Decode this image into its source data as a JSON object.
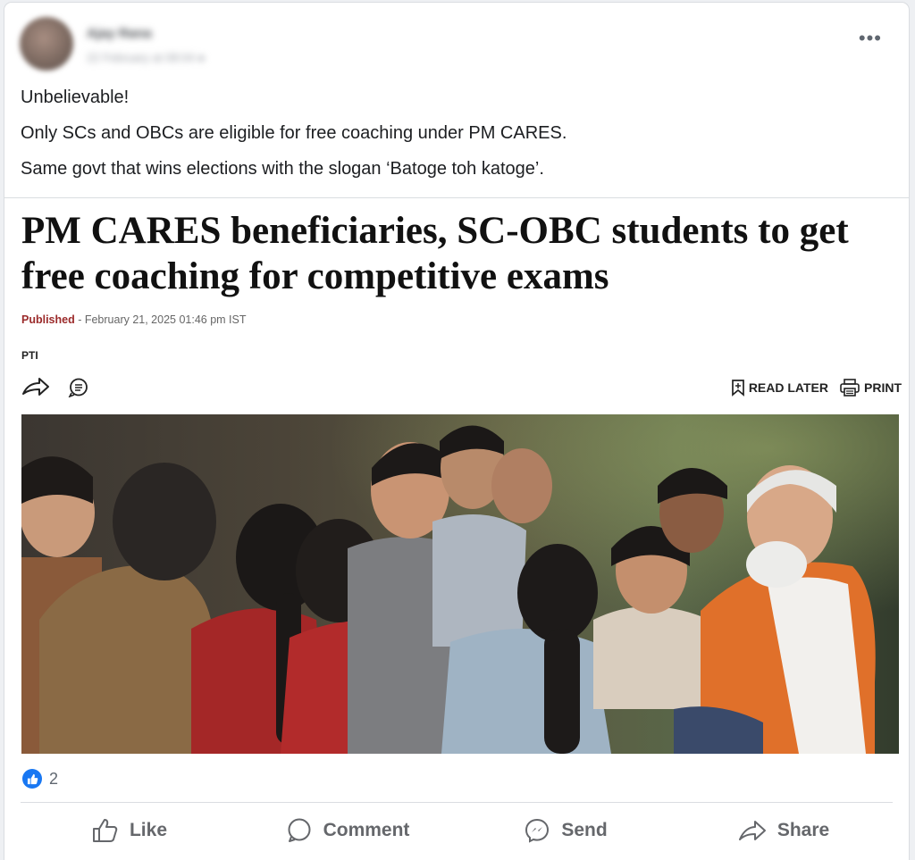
{
  "post": {
    "author": "Ajay Rana",
    "timestamp": "22 February at 08:04",
    "text_lines": [
      "Unbelievable!",
      "Only SCs and OBCs are eligible for free coaching under PM CARES.",
      "Same govt that wins elections with the slogan ‘Batoge toh katoge’."
    ],
    "more_icon": "ellipsis-icon"
  },
  "article": {
    "headline": "PM CARES beneficiaries, SC-OBC students to get free coaching for competitive exams",
    "published_label": "Published",
    "published_date": " - February 21, 2025 01:46 pm IST",
    "source": "PTI",
    "read_later_label": "READ LATER",
    "print_label": "PRINT"
  },
  "reactions": {
    "count": "2",
    "icon": "like-icon"
  },
  "actions": [
    {
      "label": "Like",
      "icon": "thumbs-up-icon"
    },
    {
      "label": "Comment",
      "icon": "comment-icon"
    },
    {
      "label": "Send",
      "icon": "messenger-icon"
    },
    {
      "label": "Share",
      "icon": "share-icon"
    }
  ],
  "colors": {
    "accent": "#1877f2",
    "published": "#9b2a2a",
    "vest": "#e0702a"
  }
}
